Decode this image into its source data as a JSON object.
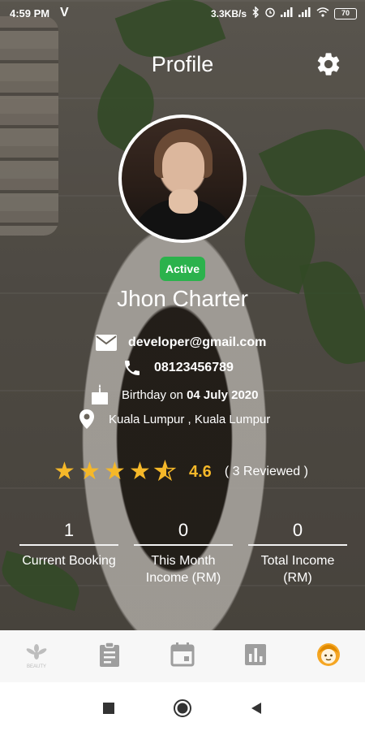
{
  "status_bar": {
    "time": "4:59 PM",
    "carrier_glyph": "V",
    "speed": "3.3KB/s",
    "battery": "70"
  },
  "header": {
    "title": "Profile",
    "settings_icon": "gear-icon"
  },
  "profile": {
    "status": "Active",
    "status_color": "#2bb24c",
    "name": "Jhon Charter",
    "email": "developer@gmail.com",
    "phone": "08123456789",
    "birthday_prefix": "Birthday on",
    "birthday_date": "04 July 2020",
    "location": "Kuala Lumpur , Kuala Lumpur"
  },
  "rating": {
    "value": "4.6",
    "reviewed": "( 3 Reviewed )",
    "stars_full": 4,
    "stars_half": 1,
    "star_color": "#f5b829"
  },
  "stats": [
    {
      "value": "1",
      "label": "Current Booking"
    },
    {
      "value": "0",
      "label": "This Month Income (RM)"
    },
    {
      "value": "0",
      "label": "Total Income (RM)"
    }
  ],
  "bottom_nav": {
    "items": [
      {
        "icon": "brand-logo-icon",
        "logo_text": "BEAUTY"
      },
      {
        "icon": "clipboard-icon"
      },
      {
        "icon": "calendar-icon"
      },
      {
        "icon": "bar-chart-icon"
      },
      {
        "icon": "profile-face-icon",
        "active": true
      }
    ],
    "active_color": "#f5a623",
    "inactive_color": "#9e9e9e"
  },
  "system_nav": [
    "square-recent-icon",
    "circle-home-icon",
    "triangle-back-icon"
  ]
}
